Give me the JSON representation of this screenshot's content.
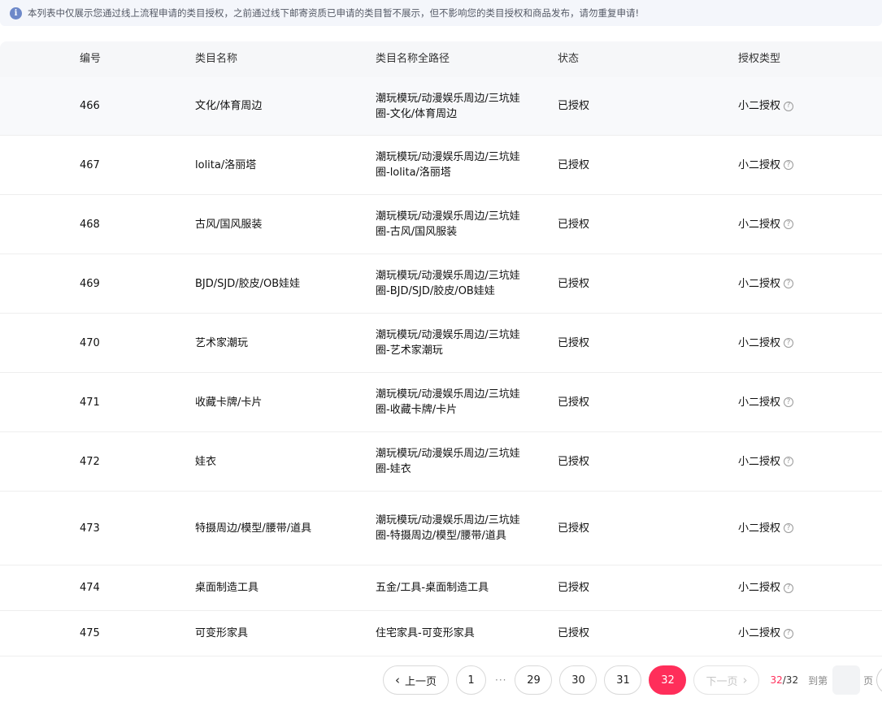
{
  "notice": {
    "icon": "info-icon",
    "icon_glyph": "i",
    "text": "本列表中仅展示您通过线上流程申请的类目授权，之前通过线下邮寄资质已申请的类目暂不展示，但不影响您的类目授权和商品发布，请勿重复申请!"
  },
  "table": {
    "headers": {
      "id": "编号",
      "name": "类目名称",
      "path": "类目名称全路径",
      "status": "状态",
      "type": "授权类型"
    },
    "rows": [
      {
        "id": "466",
        "name": "文化/体育周边",
        "path": "潮玩模玩/动漫娱乐周边/三坑娃圈-文化/体育周边",
        "status": "已授权",
        "type": "小二授权"
      },
      {
        "id": "467",
        "name": "lolita/洛丽塔",
        "path": "潮玩模玩/动漫娱乐周边/三坑娃圈-lolita/洛丽塔",
        "status": "已授权",
        "type": "小二授权"
      },
      {
        "id": "468",
        "name": "古风/国风服装",
        "path": "潮玩模玩/动漫娱乐周边/三坑娃圈-古风/国风服装",
        "status": "已授权",
        "type": "小二授权"
      },
      {
        "id": "469",
        "name": "BJD/SJD/胶皮/OB娃娃",
        "path": "潮玩模玩/动漫娱乐周边/三坑娃圈-BJD/SJD/胶皮/OB娃娃",
        "status": "已授权",
        "type": "小二授权"
      },
      {
        "id": "470",
        "name": "艺术家潮玩",
        "path": "潮玩模玩/动漫娱乐周边/三坑娃圈-艺术家潮玩",
        "status": "已授权",
        "type": "小二授权"
      },
      {
        "id": "471",
        "name": "收藏卡牌/卡片",
        "path": "潮玩模玩/动漫娱乐周边/三坑娃圈-收藏卡牌/卡片",
        "status": "已授权",
        "type": "小二授权"
      },
      {
        "id": "472",
        "name": "娃衣",
        "path": "潮玩模玩/动漫娱乐周边/三坑娃圈-娃衣",
        "status": "已授权",
        "type": "小二授权"
      },
      {
        "id": "473",
        "name": "特摄周边/模型/腰带/道具",
        "path": "潮玩模玩/动漫娱乐周边/三坑娃圈-特摄周边/模型/腰带/道具",
        "status": "已授权",
        "type": "小二授权"
      },
      {
        "id": "474",
        "name": "桌面制造工具",
        "path": "五金/工具-桌面制造工具",
        "status": "已授权",
        "type": "小二授权"
      },
      {
        "id": "475",
        "name": "可变形家具",
        "path": "住宅家具-可变形家具",
        "status": "已授权",
        "type": "小二授权"
      }
    ],
    "help_icon": "question-circle-icon",
    "help_glyph": "?"
  },
  "pagination": {
    "prev_label": "上一页",
    "prev_icon": "chevron-left-icon",
    "prev_glyph": "‹",
    "pages": [
      "1",
      "29",
      "30",
      "31",
      "32"
    ],
    "ellipsis": "···",
    "active_page": "32",
    "next_label": "下一页",
    "next_icon": "chevron-right-icon",
    "next_glyph": "›",
    "current": "32",
    "total_sep": "/32",
    "goto_prefix": "到第",
    "goto_suffix": "页",
    "goto_value": "",
    "accent_color": "#ff2e5a"
  }
}
